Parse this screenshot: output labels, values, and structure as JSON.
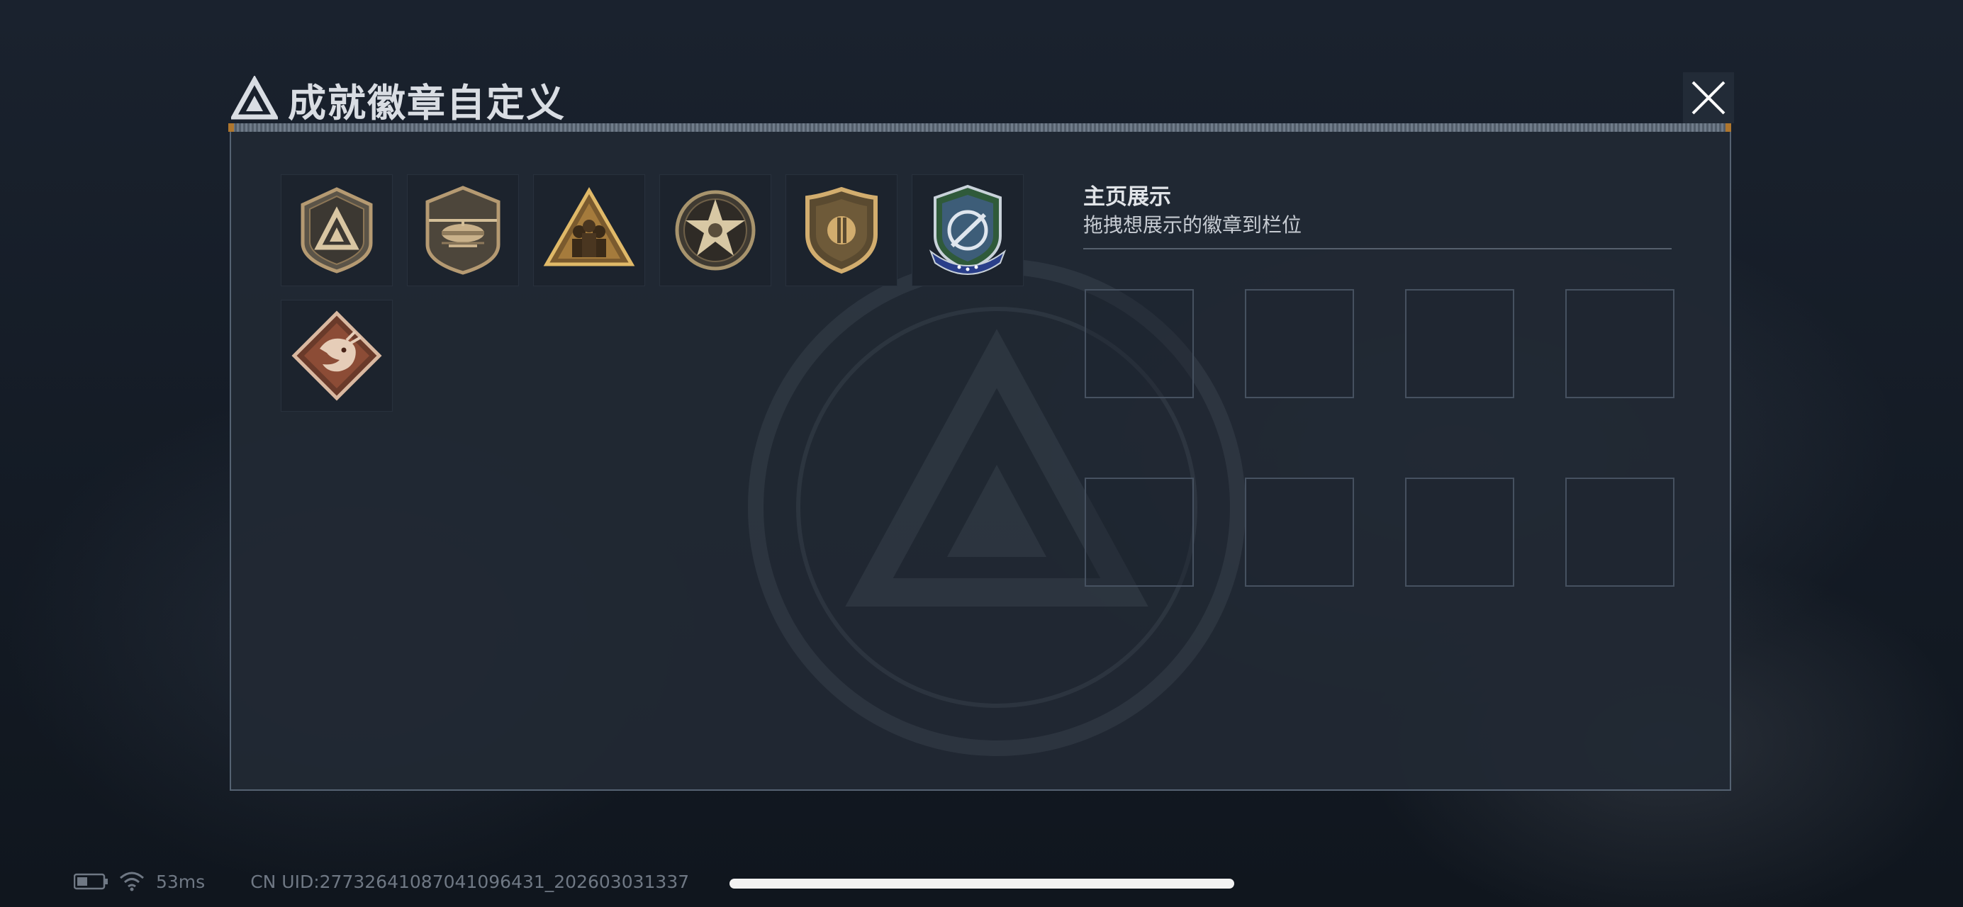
{
  "header": {
    "title": "成就徽章自定义",
    "close_icon": "close-icon",
    "logo_icon": "delta-triangle-logo"
  },
  "badges": [
    {
      "name": "delta-shield-badge",
      "color": "#b59a72"
    },
    {
      "name": "helicopter-badge",
      "color": "#b59a72"
    },
    {
      "name": "squad-triangle-badge",
      "color": "#c9a25a"
    },
    {
      "name": "star-emblem-badge",
      "color": "#c9b68e"
    },
    {
      "name": "gold-shield-badge",
      "color": "#c3a06a"
    },
    {
      "name": "green-winged-crest-badge",
      "color": "#4f8a5a"
    },
    {
      "name": "dragon-diamond-badge",
      "color": "#a8654a"
    }
  ],
  "showcase": {
    "title": "主页展示",
    "subtitle": "拖拽想展示的徽章到栏位",
    "slot_count": 8
  },
  "status_bar": {
    "ping": "53ms",
    "uid": "CN UID:27732641087041096431_202603031337",
    "battery_icon": "battery-icon",
    "wifi_icon": "wifi-icon"
  },
  "colors": {
    "panel_bg": "#212934",
    "accent_orange": "#c9862f",
    "text_primary": "#e1e4e8"
  }
}
